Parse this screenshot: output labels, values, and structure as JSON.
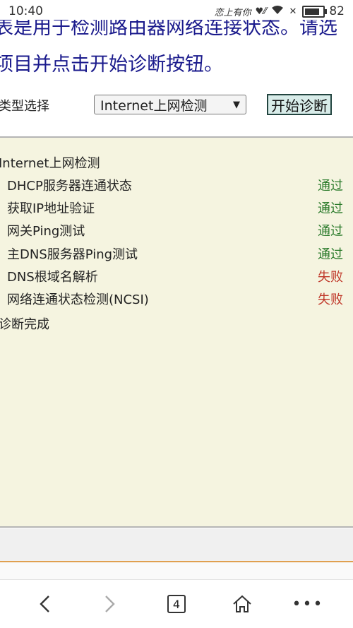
{
  "status_bar": {
    "time": "10:40",
    "carrier": "恋上有你",
    "battery": "82",
    "battery_level": 0.82
  },
  "intro": {
    "line1": "表是用于检测路由器网络连接状态。请选",
    "line2": "项目并点击开始诊断按钮。"
  },
  "diagnosis": {
    "type_label": "类型选择",
    "type_selected": "Internet上网检测",
    "start_button": "开始诊断"
  },
  "results": {
    "heading": "Internet上网检测",
    "rows": [
      {
        "name": "DHCP服务器连通状态",
        "status": "通过"
      },
      {
        "name": "获取IP地址验证",
        "status": "通过"
      },
      {
        "name": "网关Ping测试",
        "status": "通过"
      },
      {
        "name": "主DNS服务器Ping测试",
        "status": "通过"
      },
      {
        "name": "DNS根域名解析",
        "status": "失败"
      },
      {
        "name": "网络连通状态检测(NCSI)",
        "status": "失败"
      }
    ],
    "done": "诊断完成"
  },
  "colors": {
    "pass": "#2a7a2a",
    "fail": "#c0392b",
    "panel_bg": "#f5f4e0",
    "intro_text": "#1a1a8c"
  },
  "nav": {
    "tab_count": "4"
  }
}
